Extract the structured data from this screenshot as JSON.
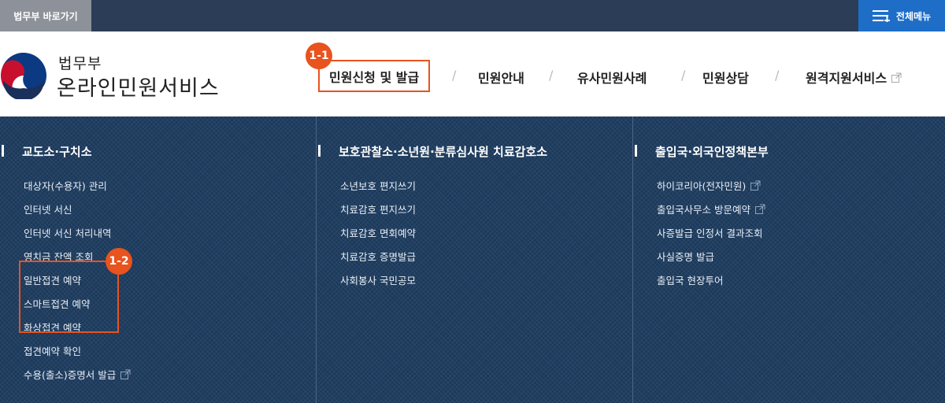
{
  "topbar": {
    "moj_link": "법무부 바로가기",
    "allmenu_label": "전체메뉴"
  },
  "logo": {
    "sub": "법무부",
    "main": "온라인민원서비스"
  },
  "nav": [
    {
      "label": "민원신청 및 발급",
      "active": true,
      "external": false
    },
    {
      "label": "민원안내",
      "active": false,
      "external": false
    },
    {
      "label": "유사민원사례",
      "active": false,
      "external": false
    },
    {
      "label": "민원상담",
      "active": false,
      "external": false
    },
    {
      "label": "원격지원서비스",
      "active": false,
      "external": true
    }
  ],
  "separator": "/",
  "badges": {
    "b1": "1-1",
    "b2": "1-2"
  },
  "menu": {
    "columns": [
      {
        "title": "교도소·구치소",
        "items": [
          {
            "label": "대상자(수용자) 관리"
          },
          {
            "label": "인터넷 서신"
          },
          {
            "label": "인터넷 서신 처리내역"
          },
          {
            "label": "영치금 잔액 조회"
          },
          {
            "label": "일반접견 예약"
          },
          {
            "label": "스마트접견 예약"
          },
          {
            "label": "화상접견 예약"
          },
          {
            "label": "접견예약 확인"
          },
          {
            "label": "수용(출소)증명서 발급",
            "external": true
          }
        ]
      },
      {
        "title": "보호관찰소·소년원·분류심사원 치료감호소",
        "items": [
          {
            "label": "소년보호 편지쓰기"
          },
          {
            "label": "치료감호 편지쓰기"
          },
          {
            "label": "치료감호 면회예약"
          },
          {
            "label": "치료감호 증명발급"
          },
          {
            "label": "사회봉사 국민공모"
          }
        ]
      },
      {
        "title": "출입국·외국인정책본부",
        "items": [
          {
            "label": "하이코리아(전자민원)",
            "external": true
          },
          {
            "label": "출입국사무소 방문예약",
            "external": true
          },
          {
            "label": "사증발급 인정서 결과조회"
          },
          {
            "label": "사실증명 발급"
          },
          {
            "label": "출입국 현장투어"
          }
        ]
      }
    ]
  },
  "colors": {
    "topbar": "#2b3d57",
    "moj_link_bg": "#8d929a",
    "allmenu_bg": "#1e6ec8",
    "menu_bg": "#1c3a5c",
    "accent": "#e8531e"
  }
}
